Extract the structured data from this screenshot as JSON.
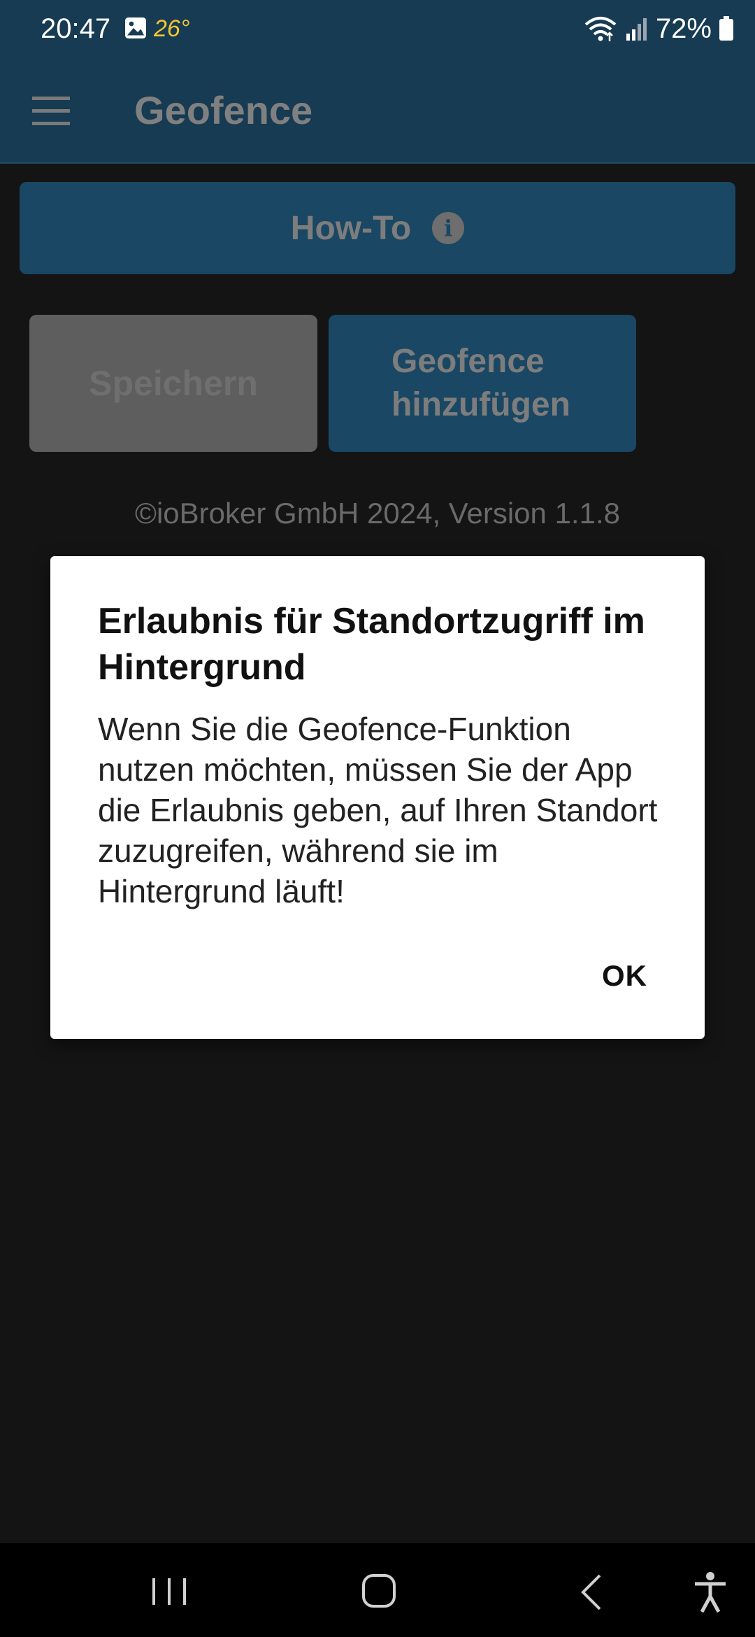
{
  "status_bar": {
    "time": "20:47",
    "gallery_icon": "image-icon",
    "temperature": "26°",
    "wifi_icon": "wifi-icon",
    "signal_icon": "signal-icon",
    "battery_percent": "72%",
    "battery_icon": "battery-icon"
  },
  "app_bar": {
    "menu_icon": "hamburger-menu-icon",
    "title": "Geofence"
  },
  "content": {
    "howto_label": "How-To",
    "info_icon": "info-icon",
    "save_label": "Speichern",
    "add_geofence_label": "Geofence\nhinzufügen",
    "copyright": "©ioBroker GmbH 2024, Version 1.1.8"
  },
  "dialog": {
    "title": "Erlaubnis für Standortzugriff im Hintergrund",
    "message": "Wenn Sie die Geofence-Funktion nutzen möchten, müssen Sie der App die Erlaubnis geben, auf Ihren Standort zuzugreifen, während sie im Hintergrund läuft!",
    "ok_label": "OK"
  },
  "nav_bar": {
    "recents_icon": "recents-icon",
    "home_icon": "home-icon",
    "back_icon": "back-icon",
    "accessibility_icon": "accessibility-icon"
  },
  "colors": {
    "app_bar": "#173b52",
    "button_primary": "#1a4764",
    "button_disabled": "#5e5e5e",
    "background": "#141414",
    "temperature": "#f3c533"
  }
}
